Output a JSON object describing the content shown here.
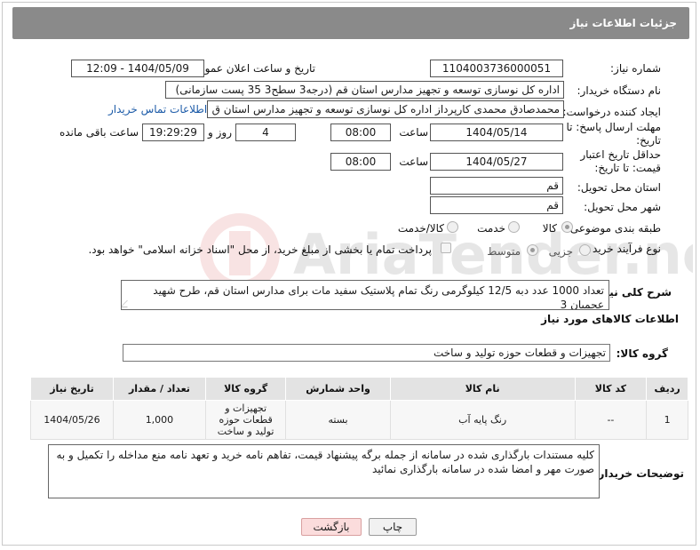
{
  "header": {
    "title": "جزئیات اطلاعات نیاز"
  },
  "watermark": {
    "text": "AriaTender.neT"
  },
  "fields": {
    "need_number_label": "شماره نیاز:",
    "need_number": "1104003736000051",
    "announce_label": "تاریخ و ساعت اعلان عمومی:",
    "announce_value": "1404/05/09 - 12:09",
    "buyer_org_label": "نام دستگاه خریدار:",
    "buyer_org": "اداره کل نوسازی   توسعه و تجهیز مدارس استان قم (درجه3 سطح3  35 پست سازمانی)",
    "requester_label": "ایجاد کننده درخواست:",
    "requester": "محمدصادق محمدی کارپرداز  اداره کل نوسازی   توسعه و تجهیز مدارس استان ق",
    "buyer_contact_link": "اطلاعات تماس خریدار",
    "deadline_label": "مهلت ارسال پاسخ: تا تاریخ:",
    "deadline_date": "1404/05/14",
    "time_label": "ساعت",
    "deadline_time": "08:00",
    "days_value": "4",
    "days_label": "روز و",
    "remaining_time": "19:29:29",
    "remaining_label": "ساعت باقی مانده",
    "validity_label": "حداقل تاریخ اعتبار قیمت: تا تاریخ:",
    "validity_date": "1404/05/27",
    "validity_time": "08:00",
    "province_label": "استان محل تحویل:",
    "province": "قم",
    "city_label": "شهر محل تحویل:",
    "city": "قم",
    "category_label": "طبقه بندی موضوعی:",
    "category_options": [
      "کالا",
      "خدمت",
      "کالا/خدمت"
    ],
    "process_label": "نوع فرآیند خرید :",
    "process_options": [
      "جزیی",
      "متوسط"
    ],
    "payment_note": "پرداخت تمام یا بخشی از مبلغ خرید، از محل \"اسناد خزانه اسلامی\" خواهد بود."
  },
  "description": {
    "label": "شرح کلی نیاز:",
    "text": "تعداد 1000 عدد دبه 12/5 کیلوگرمی رنگ تمام پلاستیک سفید مات برای مدارس استان قم، طرح شهید عجمیان 3"
  },
  "goods": {
    "section_title": "اطلاعات کالاهای مورد نیاز",
    "group_label": "گروه کالا:",
    "group_value": "تجهیزات و قطعات حوزه تولید و ساخت",
    "columns": [
      "ردیف",
      "کد کالا",
      "نام کالا",
      "واحد شمارش",
      "گروه کالا",
      "تعداد / مقدار",
      "تاریخ نیاز"
    ],
    "rows": [
      {
        "row": "1",
        "code": "--",
        "name": "رنگ پایه آب",
        "unit": "بسته",
        "group": "تجهیزات و قطعات حوزه تولید و ساخت",
        "qty": "1,000",
        "date": "1404/05/26"
      }
    ]
  },
  "buyer_notes": {
    "label": "توضیحات خریدار:",
    "text": "کلیه مستندات بارگذاری شده در سامانه از جمله برگه پیشنهاد قیمت، تفاهم نامه خرید و تعهد نامه منع مداخله را تکمیل و به صورت مهر و امضا شده در سامانه بارگذاری نمائید"
  },
  "buttons": {
    "print": "چاپ",
    "back": "بازگشت"
  },
  "colors": {
    "header_bg": "#8a8a8a",
    "link": "#1c5ba8",
    "back_button": "#fbdcdc"
  }
}
